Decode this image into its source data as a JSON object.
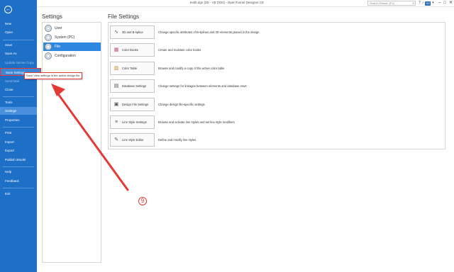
{
  "window": {
    "title": "testb.dgn [3D - V8 DGN] - OpenTunnel Designer CE",
    "search_placeholder": "Search Ribbon (F4)",
    "avatar_initials": "GG"
  },
  "nav": {
    "items": [
      {
        "label": "New",
        "state": "normal"
      },
      {
        "label": "Open",
        "state": "normal"
      },
      {
        "label": "Save",
        "state": "normal"
      },
      {
        "label": "Save As",
        "state": "normal"
      },
      {
        "label": "Update Server Copy",
        "state": "dim"
      },
      {
        "label": "Save Settings",
        "state": "highlight"
      },
      {
        "label": "Send Mail",
        "state": "dim"
      },
      {
        "label": "Close",
        "state": "normal"
      },
      {
        "label": "Tools",
        "state": "normal"
      },
      {
        "label": "Settings",
        "state": "active"
      },
      {
        "label": "Properties",
        "state": "normal"
      },
      {
        "label": "Print",
        "state": "normal"
      },
      {
        "label": "Import",
        "state": "normal"
      },
      {
        "label": "Export",
        "state": "normal"
      },
      {
        "label": "Publish iModel",
        "state": "normal"
      },
      {
        "label": "Help",
        "state": "normal"
      },
      {
        "label": "Feedback",
        "state": "normal"
      },
      {
        "label": "Exit",
        "state": "normal"
      }
    ]
  },
  "tooltip": "Save View settings in the active design file",
  "settings": {
    "heading": "Settings",
    "items": [
      {
        "label": "User"
      },
      {
        "label": "System (PC)"
      },
      {
        "label": "File"
      },
      {
        "label": "Configuration"
      }
    ]
  },
  "file_settings": {
    "heading": "File Settings",
    "rows": [
      {
        "label": "3D and B-spline",
        "icon": "spline-icon",
        "description": "Change specific attributes of B-splines and 3D elements placed in the design"
      },
      {
        "label": "Color Books",
        "icon": "color-book-icon",
        "description": "Create and maintain color books"
      },
      {
        "label": "Color Table",
        "icon": "color-table-icon",
        "description": "Browse and modify a copy of the active color table"
      },
      {
        "label": "Database Settings",
        "icon": "database-icon",
        "description": "Change settings for linkages between elements and database rows"
      },
      {
        "label": "Design File Settings",
        "icon": "design-file-icon",
        "description": "Change design file-specific settings"
      },
      {
        "label": "Line Style Settings",
        "icon": "line-style-icon",
        "description": "Browse and activate line styles and set line style modifiers"
      },
      {
        "label": "Line Style Editor",
        "icon": "line-style-editor-icon",
        "description": "Define and modify line styles"
      }
    ]
  },
  "annotation": {
    "step_number": "9",
    "color": "#e53935"
  }
}
